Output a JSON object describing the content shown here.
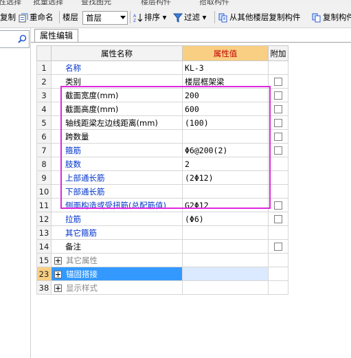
{
  "toolbar": {
    "top_strip_text": [
      "性选择",
      "批量选择",
      "查找图元",
      "楼层构件",
      "批量选择",
      "复制构件",
      "拾取构件"
    ],
    "copy_label": "复制",
    "rename_label": "重命名",
    "floor_label": "楼层",
    "floor_value": "首层",
    "sort_label": "排序",
    "filter_label": "过滤",
    "copy_from_floor_label": "从其他楼层复制构件",
    "copy_to_floor_label": "复制构件"
  },
  "tab": {
    "label": "属性编辑"
  },
  "table": {
    "headers": {
      "name": "属性名称",
      "value": "属性值",
      "extra": "附加"
    },
    "rows": [
      {
        "num": "1",
        "name": "名称",
        "value": "KL-3",
        "style": "link",
        "checkbox": false
      },
      {
        "num": "2",
        "name": "类别",
        "value": "楼层框架梁",
        "style": "plain",
        "checkbox": true
      },
      {
        "num": "3",
        "name": "截面宽度(mm)",
        "value": "200",
        "style": "plain",
        "checkbox": true
      },
      {
        "num": "4",
        "name": "截面高度(mm)",
        "value": "600",
        "style": "plain",
        "checkbox": true
      },
      {
        "num": "5",
        "name": "轴线距梁左边线距离(mm)",
        "value": "(100)",
        "style": "plain",
        "checkbox": true
      },
      {
        "num": "6",
        "name": "跨数量",
        "value": "",
        "style": "plain",
        "checkbox": true
      },
      {
        "num": "7",
        "name": "箍筋",
        "value": "Φ6@200(2)",
        "style": "link",
        "checkbox": true
      },
      {
        "num": "8",
        "name": "肢数",
        "value": "2",
        "style": "link",
        "checkbox": false
      },
      {
        "num": "9",
        "name": "上部通长筋",
        "value": "(2Φ12)",
        "style": "link",
        "checkbox": false
      },
      {
        "num": "10",
        "name": "下部通长筋",
        "value": "",
        "style": "link",
        "checkbox": false
      },
      {
        "num": "11",
        "name": "侧面构造或受扭筋(总配筋值)",
        "value": "G2Φ12",
        "style": "link",
        "checkbox": true
      },
      {
        "num": "12",
        "name": "拉筋",
        "value": "(Φ6)",
        "style": "link",
        "checkbox": true
      },
      {
        "num": "13",
        "name": "其它箍筋",
        "value": "",
        "style": "link",
        "checkbox": false
      },
      {
        "num": "14",
        "name": "备注",
        "value": "",
        "style": "plain",
        "checkbox": true
      },
      {
        "num": "15",
        "name": "其它属性",
        "value": "",
        "style": "group",
        "checkbox": false
      },
      {
        "num": "23",
        "name": "锚固搭接",
        "value": "",
        "style": "group-selected",
        "checkbox": false
      },
      {
        "num": "38",
        "name": "显示样式",
        "value": "",
        "style": "group",
        "checkbox": false
      }
    ]
  },
  "colors": {
    "highlight_box": "#e025e0",
    "header_value_bg": "#f9cf83",
    "selected_row": "#3399ff",
    "link_text": "#0033cc"
  },
  "icons": [
    "copy-icon",
    "rename-icon",
    "sort-icon",
    "filter-icon",
    "copy-from-floor-icon",
    "copy-to-floor-icon",
    "search-icon"
  ]
}
